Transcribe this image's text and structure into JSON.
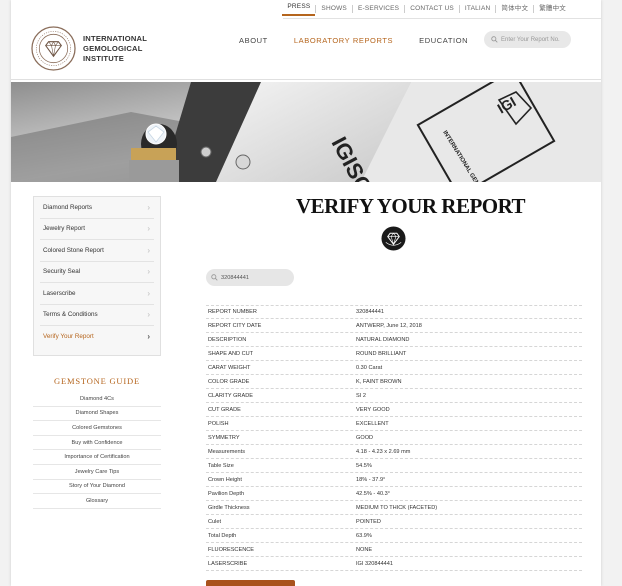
{
  "top_links": [
    "PRESS",
    "SHOWS",
    "E-SERVICES",
    "CONTACT US",
    "ITALIAN",
    "简体中文",
    "繁體中文"
  ],
  "logo": {
    "line1": "INTERNATIONAL",
    "line2": "GEMOLOGICAL",
    "line3": "INSTITUTE"
  },
  "main_nav": {
    "about": "ABOUT",
    "lab_reports": "LABORATORY REPORTS",
    "education": "EDUCATION"
  },
  "search": {
    "placeholder": "Enter Your Report No."
  },
  "banner": {
    "brand": "IGISCOPE",
    "plate_text": "INTERNATIONAL GEMOLOGICAL INSTITUTE",
    "plate_logo": "IGI"
  },
  "sidebar": [
    {
      "label": "Diamond Reports",
      "active": false
    },
    {
      "label": "Jewelry Report",
      "active": false
    },
    {
      "label": "Colored Stone Report",
      "active": false
    },
    {
      "label": "Security Seal",
      "active": false
    },
    {
      "label": "Laserscribe",
      "active": false
    },
    {
      "label": "Terms & Conditions",
      "active": false
    },
    {
      "label": "Verify Your Report",
      "active": true
    }
  ],
  "gemstone_guide": {
    "title": "GEMSTONE GUIDE",
    "items": [
      "Diamond 4Cs",
      "Diamond Shapes",
      "Colored Gemstones",
      "Buy with Confidence",
      "Importance of Certification",
      "Jewelry Care Tips",
      "Story of Your Diamond",
      "Glossary"
    ]
  },
  "page_title": "VERIFY YOUR REPORT",
  "report_search_value": "320844441",
  "report": [
    {
      "k": "REPORT NUMBER",
      "v": "320844441"
    },
    {
      "k": "REPORT CITY DATE",
      "v": "ANTWERP, June 12, 2018"
    },
    {
      "k": "DESCRIPTION",
      "v": "NATURAL DIAMOND"
    },
    {
      "k": "SHAPE AND CUT",
      "v": "ROUND BRILLIANT"
    },
    {
      "k": "CARAT WEIGHT",
      "v": "0.30 Carat"
    },
    {
      "k": "COLOR GRADE",
      "v": "K, FAINT BROWN"
    },
    {
      "k": "CLARITY GRADE",
      "v": "SI 2"
    },
    {
      "k": "CUT GRADE",
      "v": "VERY GOOD"
    },
    {
      "k": "POLISH",
      "v": "EXCELLENT"
    },
    {
      "k": "SYMMETRY",
      "v": "GOOD"
    },
    {
      "k": "Measurements",
      "v": "4.18 - 4.23 x 2.69 mm"
    },
    {
      "k": "Table Size",
      "v": "54.5%"
    },
    {
      "k": "Crown Height",
      "v": "18% - 37.9°"
    },
    {
      "k": "Pavilion Depth",
      "v": "42.5% - 40.3°"
    },
    {
      "k": "Girdle Thickness",
      "v": "MEDIUM TO THICK (FACETED)"
    },
    {
      "k": "Culet",
      "v": "POINTED"
    },
    {
      "k": "Total Depth",
      "v": "63.9%"
    },
    {
      "k": "FLUORESCENCE",
      "v": "NONE"
    },
    {
      "k": "LASERSCRIBE",
      "v": "IGI 320844441"
    }
  ],
  "colors": {
    "accent": "#b5651d",
    "button": "#a9521c"
  }
}
